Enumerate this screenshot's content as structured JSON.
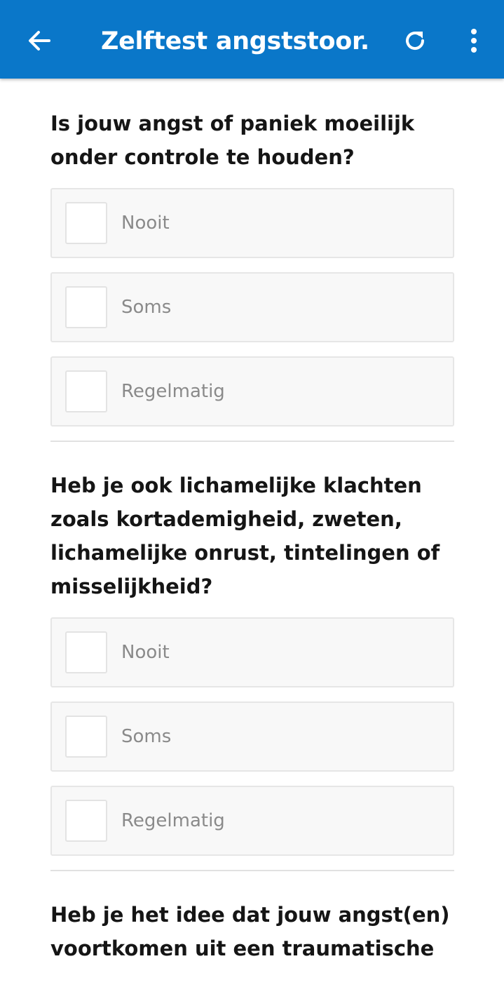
{
  "app_bar": {
    "title": "Zelftest angststoor...",
    "back_icon": "arrow-left-icon",
    "refresh_icon": "refresh-icon",
    "more_icon": "more-vertical-icon",
    "color": "#0a77c9"
  },
  "questions": [
    {
      "text": "Is jouw angst of paniek moeilijk onder controle te houden?",
      "options": [
        "Nooit",
        "Soms",
        "Regelmatig"
      ]
    },
    {
      "text": "Heb je ook lichamelijke klachten zoals kortademigheid, zweten, lichamelijke onrust, tintelingen of misselijkheid?",
      "options": [
        "Nooit",
        "Soms",
        "Regelmatig"
      ]
    },
    {
      "text": "Heb je het idee dat jouw angst(en) voortkomen uit een traumatische"
    }
  ]
}
